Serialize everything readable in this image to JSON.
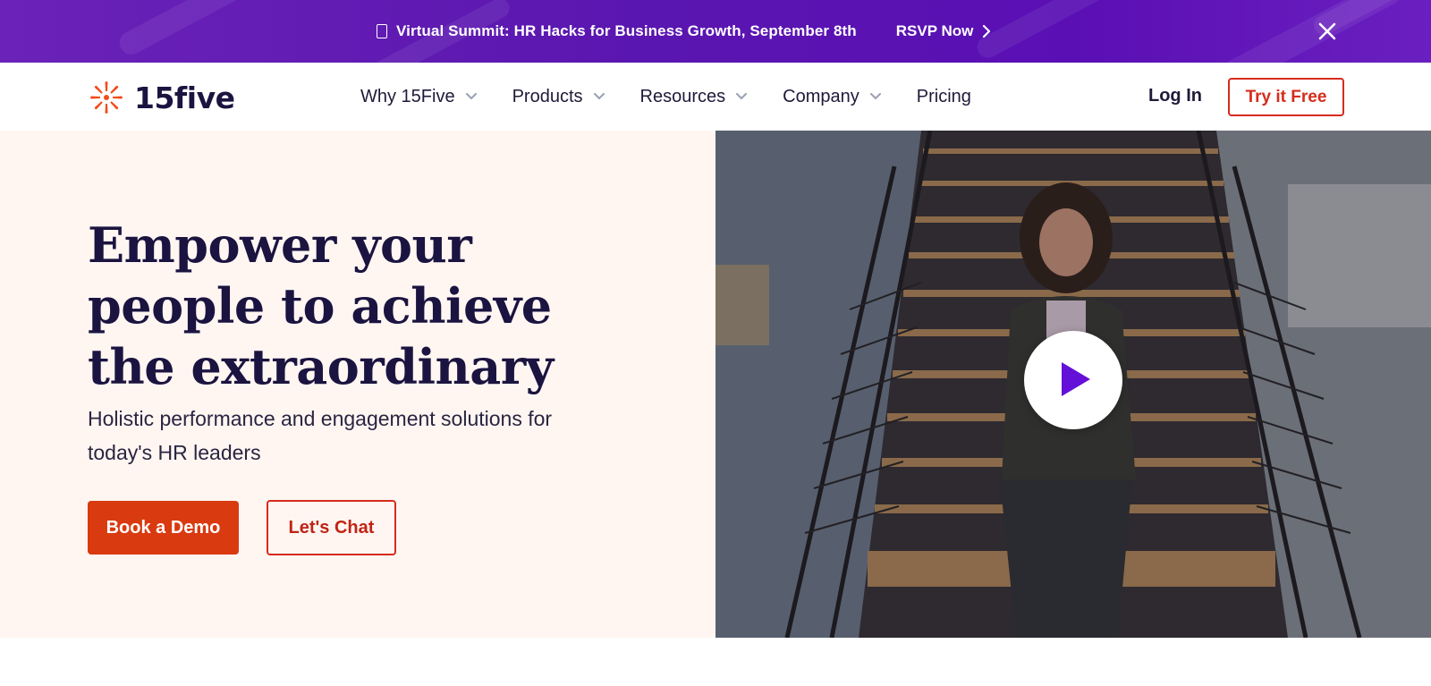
{
  "banner": {
    "text": "Virtual Summit: HR Hacks for Business Growth, September 8th",
    "cta": "RSVP Now",
    "icons": {
      "leading": "calendar-icon",
      "cta": "chevron-right-icon",
      "close": "close-icon"
    }
  },
  "nav": {
    "logo_text": "15five",
    "items": [
      {
        "label": "Why 15Five",
        "has_dropdown": true
      },
      {
        "label": "Products",
        "has_dropdown": true
      },
      {
        "label": "Resources",
        "has_dropdown": true
      },
      {
        "label": "Company",
        "has_dropdown": true
      },
      {
        "label": "Pricing",
        "has_dropdown": false
      }
    ],
    "login": "Log In",
    "try_free": "Try it Free"
  },
  "hero": {
    "headline": "Empower your people to achieve the extraordinary",
    "subhead": "Holistic performance and engagement solutions for today's HR leaders",
    "primary_cta": "Book a Demo",
    "secondary_cta": "Let's Chat"
  },
  "video": {
    "icon": "play-icon"
  },
  "colors": {
    "banner_purple": "#5a16b0",
    "brand_orange": "#d93a10",
    "brand_red": "#d62c1c",
    "navy": "#1b1440",
    "hero_bg": "#fff6f2",
    "play_purple": "#6410d8"
  }
}
